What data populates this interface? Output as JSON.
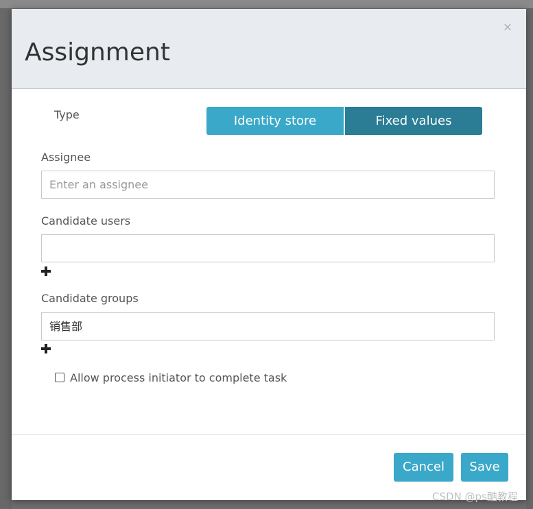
{
  "dialog": {
    "title": "Assignment",
    "close_glyph": "×"
  },
  "type": {
    "label": "Type",
    "options": [
      "Identity store",
      "Fixed values"
    ],
    "selected": "Fixed values"
  },
  "assignee": {
    "label": "Assignee",
    "placeholder": "Enter an assignee",
    "value": ""
  },
  "candidate_users": {
    "label": "Candidate users",
    "value": "",
    "add_icon": "plus-icon"
  },
  "candidate_groups": {
    "label": "Candidate groups",
    "value": "销售部",
    "add_icon": "plus-icon"
  },
  "allow_initiator": {
    "label": "Allow process initiator to complete task",
    "checked": false
  },
  "footer": {
    "cancel_label": "Cancel",
    "save_label": "Save"
  },
  "watermark": "CSDN @ps酷教程",
  "colors": {
    "primary": "#3aa8c9",
    "primary_active": "#2a7d95",
    "header_bg": "#e8ecf0"
  }
}
